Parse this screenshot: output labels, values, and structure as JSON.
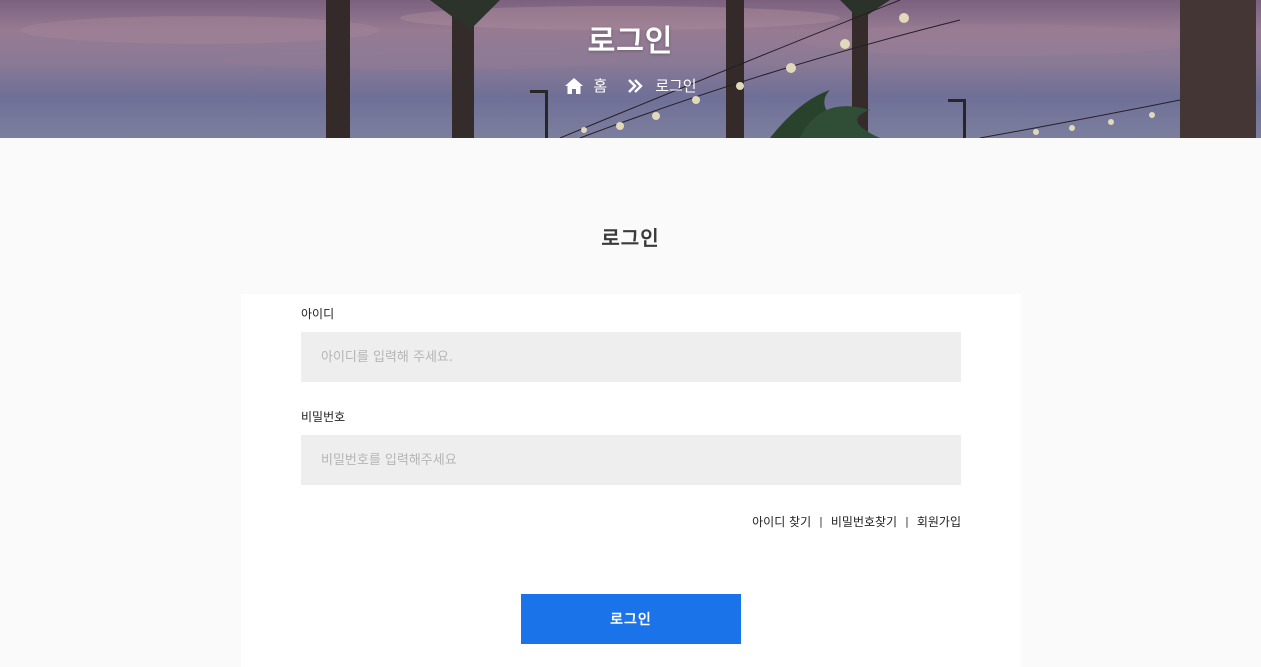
{
  "hero": {
    "title": "로그인",
    "breadcrumb": {
      "home_label": "홈",
      "current_label": "로그인"
    }
  },
  "main": {
    "heading": "로그인",
    "id_field": {
      "label": "아이디",
      "placeholder": "아이디를 입력해 주세요.",
      "value": ""
    },
    "password_field": {
      "label": "비밀번호",
      "placeholder": "비밀번호를 입력해주세요",
      "value": ""
    },
    "links": {
      "find_id": "아이디 찾기",
      "separator": "|",
      "find_password": "비밀번호찾기",
      "signup": "회원가입"
    },
    "submit_label": "로그인"
  },
  "colors": {
    "accent": "#1a73e8",
    "input_bg": "#eeeeee",
    "page_bg": "#fafafa"
  },
  "icons": {
    "home": "home-icon",
    "separator": "double-chevron-right-icon"
  }
}
